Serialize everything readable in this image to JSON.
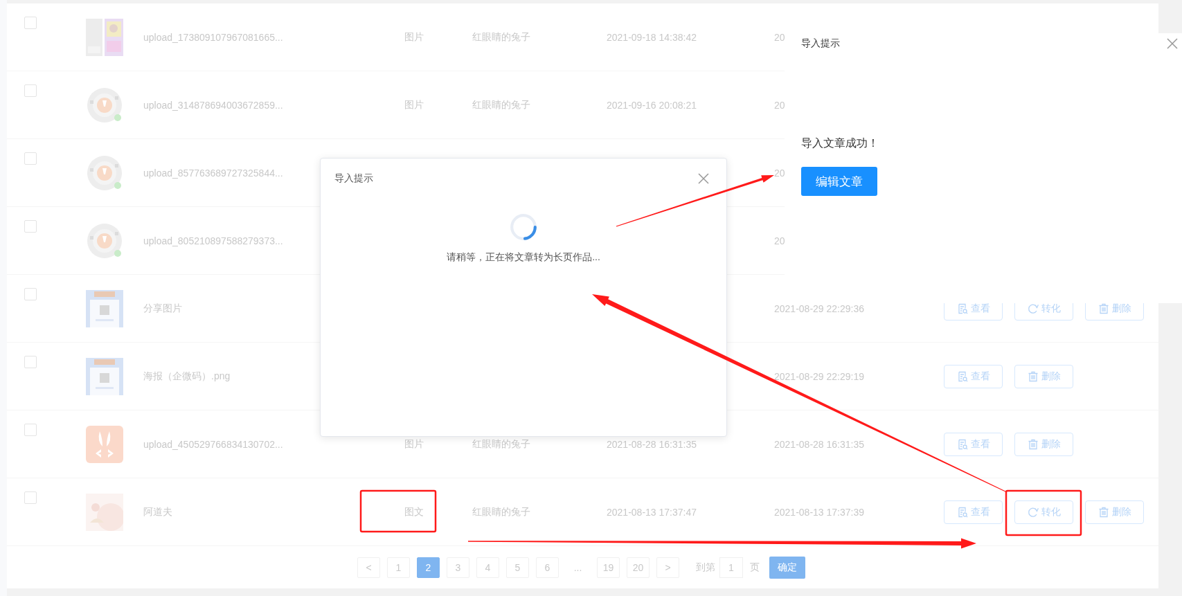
{
  "table": {
    "rows": [
      {
        "checked": false,
        "name": "upload_173809107967081665...",
        "type": "图片",
        "author": "红眼睛的兔子",
        "created": "2021-09-18 14:38:42",
        "updated": "20",
        "actions": []
      },
      {
        "checked": false,
        "name": "upload_314878694003672859...",
        "type": "图片",
        "author": "红眼睛的兔子",
        "created": "2021-09-16 20:08:21",
        "updated": "20",
        "actions": []
      },
      {
        "checked": false,
        "name": "upload_857763689727325844...",
        "updated": "20",
        "actions": []
      },
      {
        "checked": false,
        "name": "upload_805210897588279373...",
        "updated": "20",
        "actions": []
      },
      {
        "checked": false,
        "name": "分享图片",
        "updated": "2021-08-29 22:29:36",
        "actions": [
          {
            "kind": "view",
            "label": "查看"
          },
          {
            "kind": "convert",
            "label": "转化"
          },
          {
            "kind": "delete",
            "label": "删除"
          }
        ]
      },
      {
        "checked": false,
        "name": "海报（企微码）.png",
        "updated": "2021-08-29 22:29:19",
        "actions": [
          {
            "kind": "view",
            "label": "查看"
          },
          {
            "kind": "delete",
            "label": "删除"
          }
        ]
      },
      {
        "checked": false,
        "name": "upload_450529766834130702...",
        "type": "图片",
        "author": "红眼睛的兔子",
        "created": "2021-08-28 16:31:35",
        "updated": "2021-08-28 16:31:35",
        "actions": [
          {
            "kind": "view",
            "label": "查看"
          },
          {
            "kind": "delete",
            "label": "删除"
          }
        ]
      },
      {
        "checked": false,
        "name": "阿道夫",
        "type": "图文",
        "author": "红眼睛的兔子",
        "created": "2021-08-13 17:37:47",
        "updated": "2021-08-13 17:37:39",
        "actions": [
          {
            "kind": "view",
            "label": "查看"
          },
          {
            "kind": "convert",
            "label": "转化"
          },
          {
            "kind": "delete",
            "label": "删除"
          }
        ]
      }
    ]
  },
  "pagination": {
    "pages": [
      {
        "kind": "prev",
        "label": "<",
        "selected": false
      },
      {
        "kind": "page",
        "label": "1",
        "selected": false
      },
      {
        "kind": "page",
        "label": "2",
        "selected": true
      },
      {
        "kind": "page",
        "label": "3",
        "selected": false
      },
      {
        "kind": "page",
        "label": "4",
        "selected": false
      },
      {
        "kind": "page",
        "label": "5",
        "selected": false
      },
      {
        "kind": "page",
        "label": "6",
        "selected": false
      },
      {
        "kind": "ellipsis",
        "label": "...",
        "selected": false
      },
      {
        "kind": "page",
        "label": "19",
        "selected": false
      },
      {
        "kind": "page",
        "label": "20",
        "selected": false
      },
      {
        "kind": "next",
        "label": ">",
        "selected": false
      }
    ],
    "goto_label": "到第",
    "goto_value": "1",
    "goto_unit": "页",
    "confirm": "确定"
  },
  "loading_dialog": {
    "title": "导入提示",
    "message": "请稍等，正在将文章转为长页作品..."
  },
  "success_dialog": {
    "title": "导入提示",
    "message": "导入文章成功！",
    "button": "编辑文章"
  }
}
